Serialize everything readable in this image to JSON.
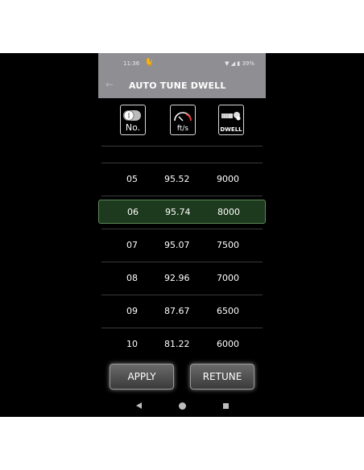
{
  "status": {
    "time": "11:36",
    "battery": "39%"
  },
  "appbar": {
    "title": "AUTO TUNE DWELL"
  },
  "header": {
    "no_label": "No.",
    "speed_label": "ft/s",
    "dwell_label": "DWELL"
  },
  "rows": [
    {
      "no": "05",
      "speed": "95.52",
      "dwell": "9000"
    },
    {
      "no": "06",
      "speed": "95.74",
      "dwell": "8000",
      "selected": true
    },
    {
      "no": "07",
      "speed": "95.07",
      "dwell": "7500"
    },
    {
      "no": "08",
      "speed": "92.96",
      "dwell": "7000"
    },
    {
      "no": "09",
      "speed": "87.67",
      "dwell": "6500"
    },
    {
      "no": "10",
      "speed": "81.22",
      "dwell": "6000"
    }
  ],
  "buttons": {
    "apply": "APPLY",
    "retune": "RETUNE"
  },
  "colors": {
    "appbar": "#8f8f93",
    "selected_row": "#1e3a1e",
    "selected_border": "#5a8a55"
  }
}
